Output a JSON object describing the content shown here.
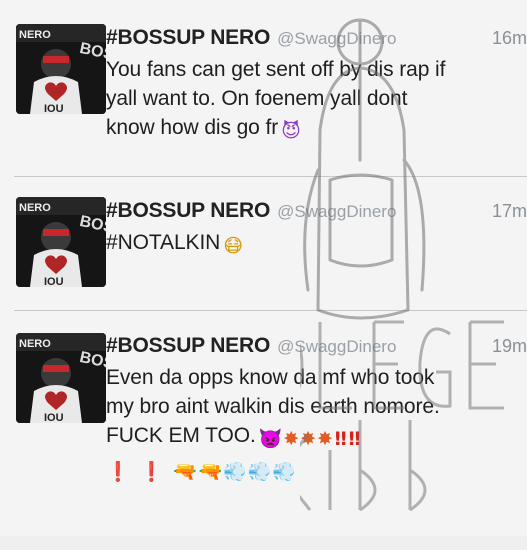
{
  "tweets": [
    {
      "name": "#BOSSUP NERO",
      "handle": "@SwaggDinero",
      "time": "16m",
      "lines": [
        "You fans can get sent off by dis rap if",
        "yall want to. On foenem yall dont",
        "know how dis go fr"
      ],
      "emoji": [
        "smiling-devil-icon"
      ]
    },
    {
      "name": "#BOSSUP NERO",
      "handle": "@SwaggDinero",
      "time": "17m",
      "lines": [
        "#NOTALKIN"
      ],
      "emoji": [
        "medical-mask-face-icon"
      ]
    },
    {
      "name": "#BOSSUP NERO",
      "handle": "@SwaggDinero",
      "time": "19m",
      "lines": [
        "Even da opps know da mf who took",
        "my bro aint walkin dis earth nomore.",
        "FUCK EM TOO."
      ],
      "emoji": [
        "angry-devil-icon",
        "collision-icon",
        "collision-icon",
        "collision-icon",
        "double-exclamation-icon",
        "double-exclamation-icon",
        "exclamation-icon",
        "exclamation-icon",
        "pistol-icon",
        "pistol-icon",
        "dash-icon",
        "dash-icon",
        "dash-icon"
      ]
    }
  ],
  "colors": {
    "background": "#f4f4f4",
    "name": "#222222",
    "handle": "#9aa0a6",
    "divider": "#c8c8c8"
  },
  "watermark_icon": "kollege-kidd-backpack-watermark-icon"
}
